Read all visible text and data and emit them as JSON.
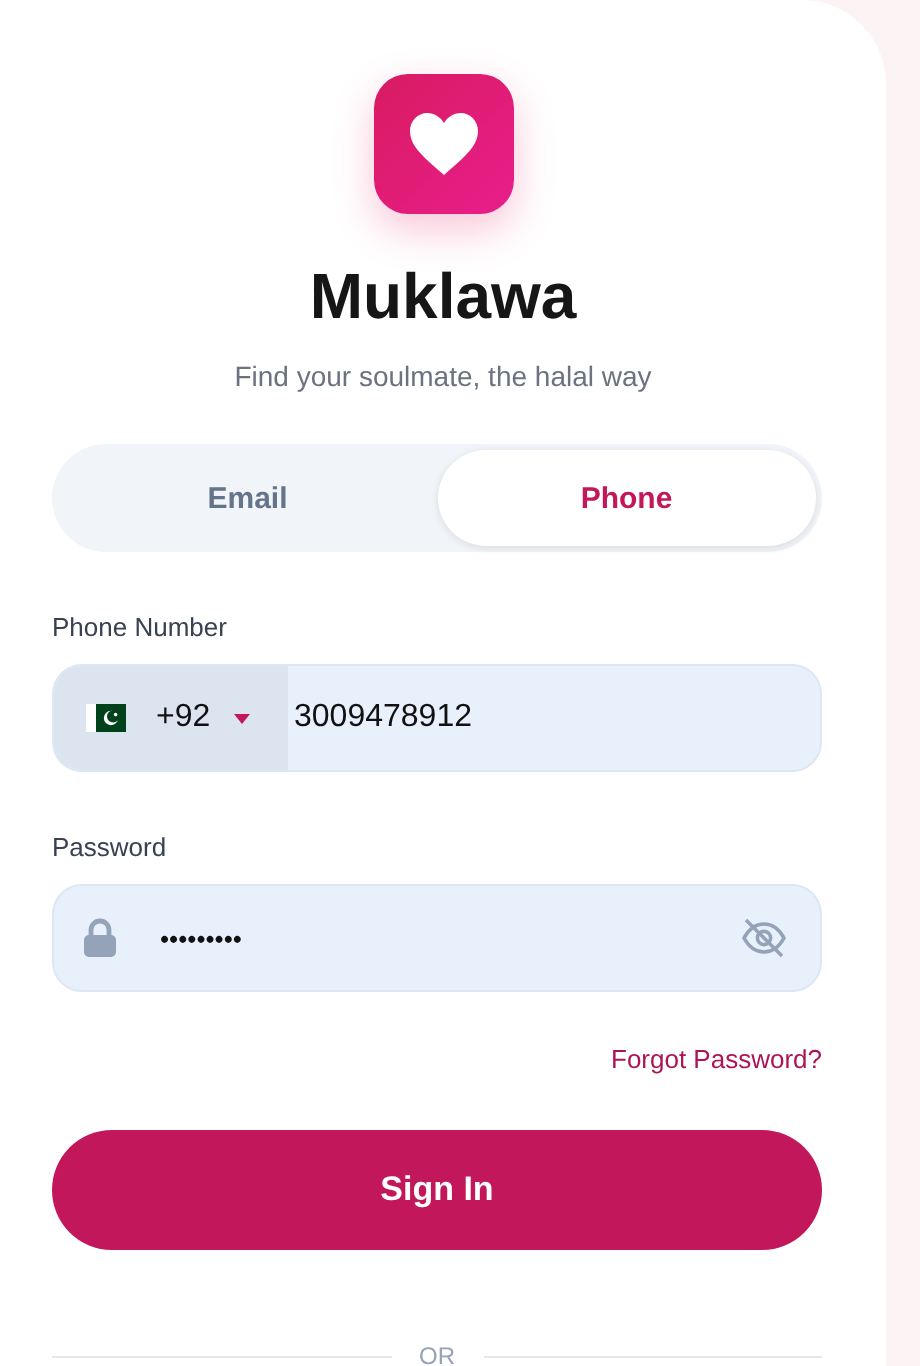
{
  "app": {
    "name": "Muklawa",
    "tagline": "Find your soulmate, the halal way"
  },
  "tabs": [
    {
      "label": "Email",
      "selected": false
    },
    {
      "label": "Phone",
      "selected": true
    }
  ],
  "phone": {
    "label": "Phone Number",
    "country_code": "+92",
    "value": "3009478912"
  },
  "password": {
    "label": "Password",
    "value": "•••••••••",
    "visible": false
  },
  "forgot_link": "Forgot Password?",
  "submit": "Sign In",
  "divider": "OR"
}
